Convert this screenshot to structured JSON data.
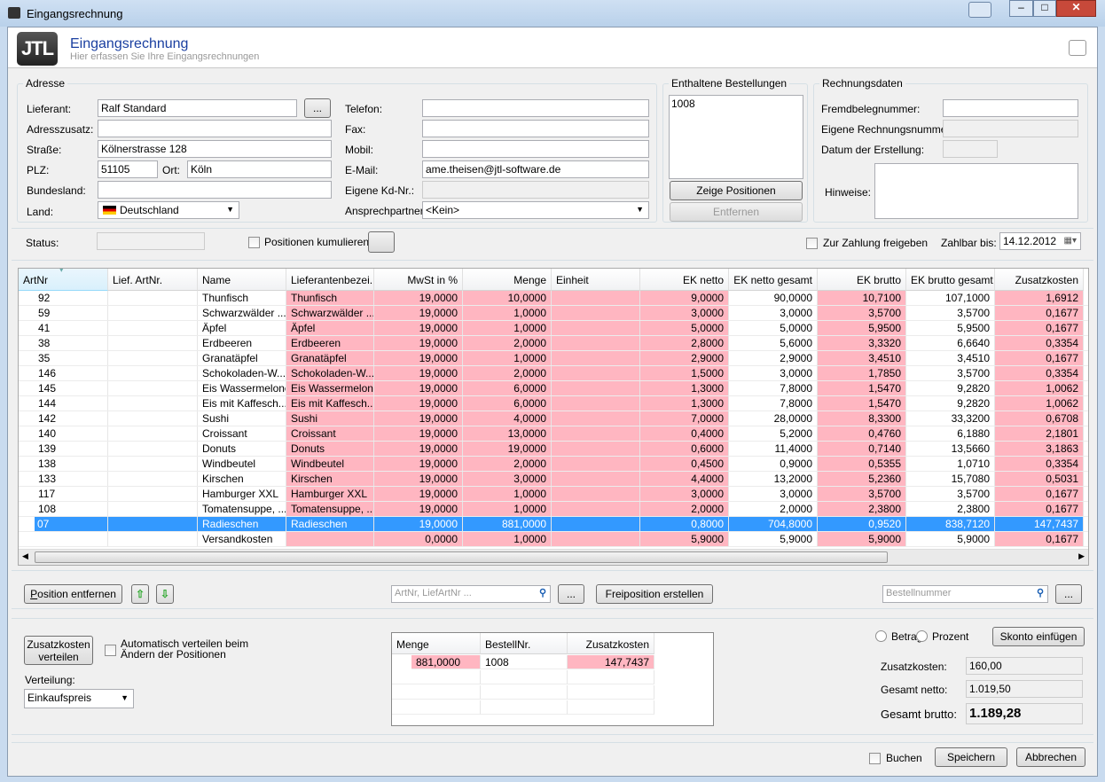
{
  "window": {
    "title": "Eingangsrechnung"
  },
  "header": {
    "logo": "JTL",
    "title": "Eingangsrechnung",
    "subtitle": "Hier erfassen Sie Ihre Eingangsrechnungen"
  },
  "adresse": {
    "legend": "Adresse",
    "lieferant_label": "Lieferant:",
    "lieferant": "Ralf Standard",
    "browse": "...",
    "adresszusatz_label": "Adresszusatz:",
    "adresszusatz": "",
    "strasse_label": "Straße:",
    "strasse": "Kölnerstrasse 128",
    "plz_label": "PLZ:",
    "plz": "51105",
    "ort_label": "Ort:",
    "ort": "Köln",
    "bundesland_label": "Bundesland:",
    "bundesland": "",
    "land_label": "Land:",
    "land": "Deutschland",
    "telefon_label": "Telefon:",
    "fax_label": "Fax:",
    "mobil_label": "Mobil:",
    "email_label": "E-Mail:",
    "email": "ame.theisen@jtl-software.de",
    "kdnr_label": "Eigene Kd-Nr.:",
    "ansprech_label": "Ansprechpartner:",
    "ansprech": "<Kein>"
  },
  "bestellungen": {
    "legend": "Enthaltene Bestellungen",
    "items": [
      "1008"
    ],
    "show": "Zeige Positionen",
    "remove": "Entfernen"
  },
  "rechnungsdaten": {
    "legend": "Rechnungsdaten",
    "fremd_label": "Fremdbelegnummer:",
    "eigene_label": "Eigene Rechnungsnummer:",
    "datum_label": "Datum der Erstellung:",
    "hinweise_label": "Hinweise:"
  },
  "status": {
    "label": "Status:",
    "kumulieren": "Positionen kumulieren",
    "zahlung": "Zur Zahlung freigeben",
    "zahlbar_label": "Zahlbar bis:",
    "zahlbar": "14.12.2012"
  },
  "grid": {
    "columns": [
      "ArtNr",
      "Lief. ArtNr.",
      "Name",
      "Lieferantenbezei...",
      "MwSt in %",
      "Menge",
      "Einheit",
      "EK netto",
      "EK netto gesamt",
      "EK brutto",
      "EK brutto gesamt",
      "Zusatzkosten"
    ],
    "rows": [
      [
        "92",
        "",
        "Thunfisch",
        "Thunfisch",
        "19,0000",
        "10,0000",
        "",
        "9,0000",
        "90,0000",
        "10,7100",
        "107,1000",
        "1,6912"
      ],
      [
        "59",
        "",
        "Schwarzwälder ...",
        "Schwarzwälder ...",
        "19,0000",
        "1,0000",
        "",
        "3,0000",
        "3,0000",
        "3,5700",
        "3,5700",
        "0,1677"
      ],
      [
        "41",
        "",
        "Äpfel",
        "Äpfel",
        "19,0000",
        "1,0000",
        "",
        "5,0000",
        "5,0000",
        "5,9500",
        "5,9500",
        "0,1677"
      ],
      [
        "38",
        "",
        "Erdbeeren",
        "Erdbeeren",
        "19,0000",
        "2,0000",
        "",
        "2,8000",
        "5,6000",
        "3,3320",
        "6,6640",
        "0,3354"
      ],
      [
        "35",
        "",
        "Granatäpfel",
        "Granatäpfel",
        "19,0000",
        "1,0000",
        "",
        "2,9000",
        "2,9000",
        "3,4510",
        "3,4510",
        "0,1677"
      ],
      [
        "146",
        "",
        "Schokoladen-W...",
        "Schokoladen-W...",
        "19,0000",
        "2,0000",
        "",
        "1,5000",
        "3,0000",
        "1,7850",
        "3,5700",
        "0,3354"
      ],
      [
        "145",
        "",
        "Eis Wassermelone",
        "Eis Wassermelone",
        "19,0000",
        "6,0000",
        "",
        "1,3000",
        "7,8000",
        "1,5470",
        "9,2820",
        "1,0062"
      ],
      [
        "144",
        "",
        "Eis mit Kaffesch...",
        "Eis mit Kaffesch...",
        "19,0000",
        "6,0000",
        "",
        "1,3000",
        "7,8000",
        "1,5470",
        "9,2820",
        "1,0062"
      ],
      [
        "142",
        "",
        "Sushi",
        "Sushi",
        "19,0000",
        "4,0000",
        "",
        "7,0000",
        "28,0000",
        "8,3300",
        "33,3200",
        "0,6708"
      ],
      [
        "140",
        "",
        "Croissant",
        "Croissant",
        "19,0000",
        "13,0000",
        "",
        "0,4000",
        "5,2000",
        "0,4760",
        "6,1880",
        "2,1801"
      ],
      [
        "139",
        "",
        "Donuts",
        "Donuts",
        "19,0000",
        "19,0000",
        "",
        "0,6000",
        "11,4000",
        "0,7140",
        "13,5660",
        "3,1863"
      ],
      [
        "138",
        "",
        "Windbeutel",
        "Windbeutel",
        "19,0000",
        "2,0000",
        "",
        "0,4500",
        "0,9000",
        "0,5355",
        "1,0710",
        "0,3354"
      ],
      [
        "133",
        "",
        "Kirschen",
        "Kirschen",
        "19,0000",
        "3,0000",
        "",
        "4,4000",
        "13,2000",
        "5,2360",
        "15,7080",
        "0,5031"
      ],
      [
        "117",
        "",
        "Hamburger XXL",
        "Hamburger XXL",
        "19,0000",
        "1,0000",
        "",
        "3,0000",
        "3,0000",
        "3,5700",
        "3,5700",
        "0,1677"
      ],
      [
        "108",
        "",
        "Tomatensuppe, ...",
        "Tomatensuppe, ...",
        "19,0000",
        "1,0000",
        "",
        "2,0000",
        "2,0000",
        "2,3800",
        "2,3800",
        "0,1677"
      ],
      [
        "07",
        "",
        "Radieschen",
        "Radieschen",
        "19,0000",
        "881,0000",
        "",
        "0,8000",
        "704,8000",
        "0,9520",
        "838,7120",
        "147,7437"
      ],
      [
        "",
        "",
        "Versandkosten",
        "",
        "0,0000",
        "1,0000",
        "",
        "5,9000",
        "5,9000",
        "5,9000",
        "5,9000",
        "0,1677"
      ]
    ],
    "selected_row": 15
  },
  "toolbar": {
    "remove": "Position entfernen",
    "search_placeholder": "ArtNr, LiefArtNr ...",
    "more": "...",
    "frei": "Freiposition erstellen",
    "bestell_placeholder": "Bestellnummer",
    "more2": "..."
  },
  "zusatz": {
    "button": "Zusatzkosten verteilen",
    "auto": "Automatisch verteilen beim Ändern der Positionen",
    "verteilung_label": "Verteilung:",
    "verteilung": "Einkaufspreis",
    "table": {
      "columns": [
        "Menge",
        "BestellNr.",
        "Zusatzkosten"
      ],
      "rows": [
        [
          "881,0000",
          "1008",
          "147,7437"
        ]
      ]
    }
  },
  "totals": {
    "betrag": "Betrag",
    "prozent": "Prozent",
    "skonto": "Skonto einfügen",
    "zusatz_label": "Zusatzkosten:",
    "zusatz": "160,00",
    "netto_label": "Gesamt netto:",
    "netto": "1.019,50",
    "brutto_label": "Gesamt brutto:",
    "brutto": "1.189,28"
  },
  "footer": {
    "buchen": "Buchen",
    "speichern": "Speichern",
    "abbrechen": "Abbrechen"
  }
}
